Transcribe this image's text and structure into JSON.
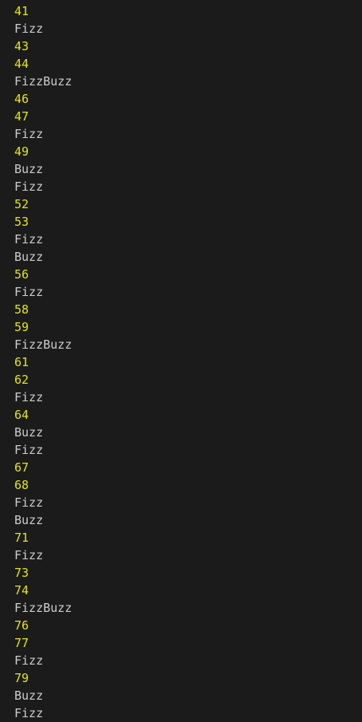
{
  "colors": {
    "background": "#1b1b1b",
    "number": "#e5e510",
    "word": "#cccccc"
  },
  "console": {
    "lines": [
      "41",
      "Fizz",
      "43",
      "44",
      "FizzBuzz",
      "46",
      "47",
      "Fizz",
      "49",
      "Buzz",
      "Fizz",
      "52",
      "53",
      "Fizz",
      "Buzz",
      "56",
      "Fizz",
      "58",
      "59",
      "FizzBuzz",
      "61",
      "62",
      "Fizz",
      "64",
      "Buzz",
      "Fizz",
      "67",
      "68",
      "Fizz",
      "Buzz",
      "71",
      "Fizz",
      "73",
      "74",
      "FizzBuzz",
      "76",
      "77",
      "Fizz",
      "79",
      "Buzz",
      "Fizz"
    ]
  }
}
